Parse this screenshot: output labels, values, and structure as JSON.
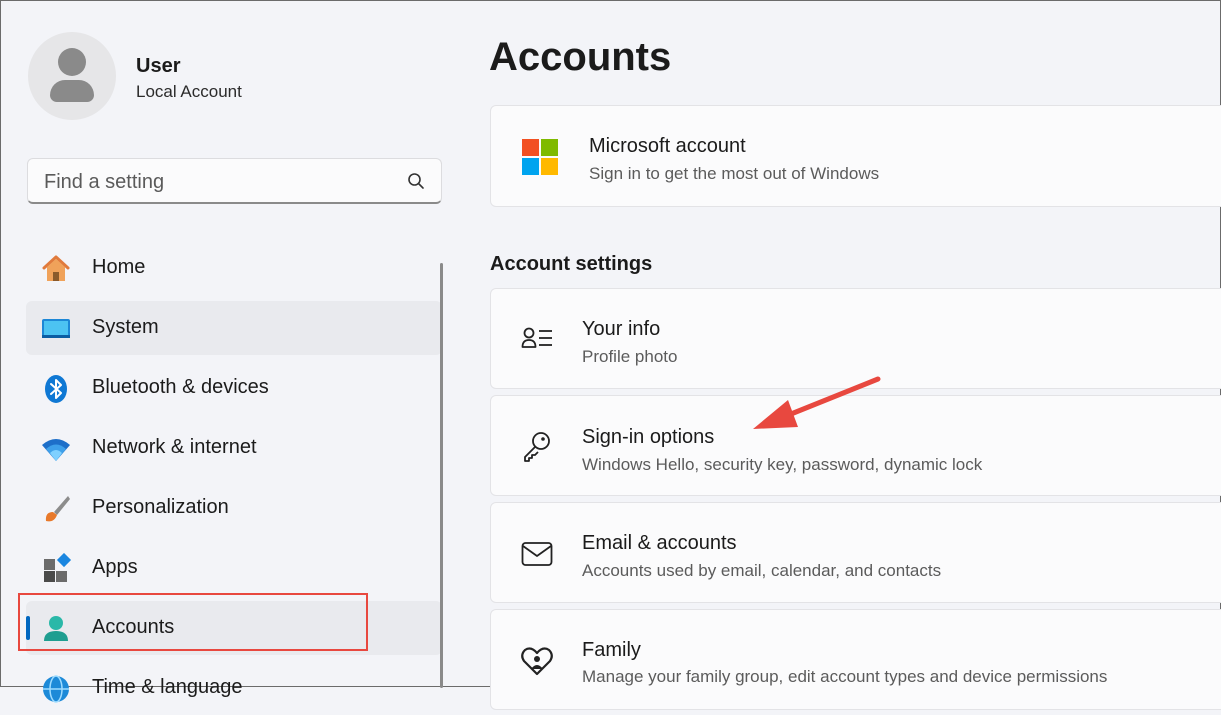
{
  "user": {
    "name": "User",
    "account_type": "Local Account"
  },
  "search": {
    "placeholder": "Find a setting"
  },
  "sidebar": {
    "items": [
      {
        "label": "Home",
        "icon": "home-icon"
      },
      {
        "label": "System",
        "icon": "monitor-icon"
      },
      {
        "label": "Bluetooth & devices",
        "icon": "bluetooth-icon"
      },
      {
        "label": "Network & internet",
        "icon": "wifi-icon"
      },
      {
        "label": "Personalization",
        "icon": "brush-icon"
      },
      {
        "label": "Apps",
        "icon": "apps-icon"
      },
      {
        "label": "Accounts",
        "icon": "accounts-icon",
        "selected": true
      },
      {
        "label": "Time & language",
        "icon": "globe-icon"
      }
    ]
  },
  "main": {
    "title": "Accounts",
    "microsoft_account": {
      "title": "Microsoft account",
      "subtitle": "Sign in to get the most out of Windows"
    },
    "section_title": "Account settings",
    "cards": [
      {
        "title": "Your info",
        "subtitle": "Profile photo",
        "icon": "profile-info-icon"
      },
      {
        "title": "Sign-in options",
        "subtitle": "Windows Hello, security key, password, dynamic lock",
        "icon": "key-icon"
      },
      {
        "title": "Email & accounts",
        "subtitle": "Accounts used by email, calendar, and contacts",
        "icon": "mail-icon"
      },
      {
        "title": "Family",
        "subtitle": "Manage your family group, edit account types and device permissions",
        "icon": "family-heart-icon"
      }
    ]
  },
  "colors": {
    "accent": "#0067c0",
    "annotation": "#e8483f"
  }
}
